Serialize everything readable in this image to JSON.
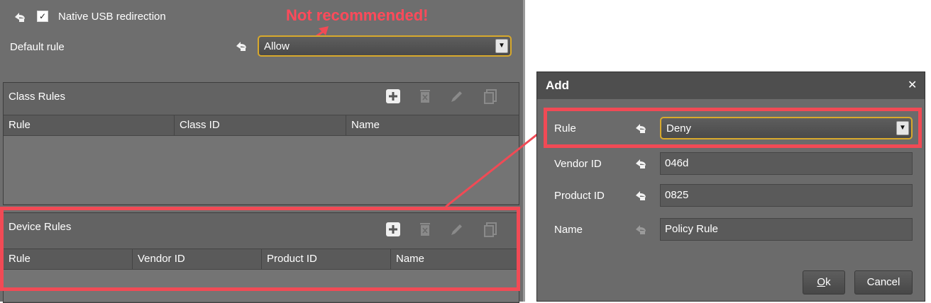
{
  "main": {
    "native_usb_label": "Native USB redirection",
    "native_usb_checked": true,
    "default_rule_label": "Default rule",
    "default_rule_value": "Allow",
    "annotation": "Not recommended!",
    "class_rules": {
      "title": "Class Rules",
      "columns": [
        "Rule",
        "Class ID",
        "Name"
      ]
    },
    "device_rules": {
      "title": "Device Rules",
      "columns": [
        "Rule",
        "Vendor ID",
        "Product ID",
        "Name"
      ]
    }
  },
  "dialog": {
    "title": "Add",
    "close_glyph": "✕",
    "rule_label": "Rule",
    "rule_value": "Deny",
    "vendor_label": "Vendor ID",
    "vendor_value": "046d",
    "product_label": "Product ID",
    "product_value": "0825",
    "name_label": "Name",
    "name_value": "Policy Rule",
    "ok_label": "k",
    "ok_mnemonic": "O",
    "cancel_label": "Cancel"
  },
  "icons": {
    "reset": "reset-icon",
    "add": "add-icon",
    "delete": "delete-icon",
    "edit": "edit-icon",
    "copy": "copy-icon",
    "dropdown": "chevron-down-icon"
  },
  "colors": {
    "highlight_red": "#f14a55",
    "dropdown_border": "#d8a92c",
    "panel_bg": "#6e6e6e"
  }
}
